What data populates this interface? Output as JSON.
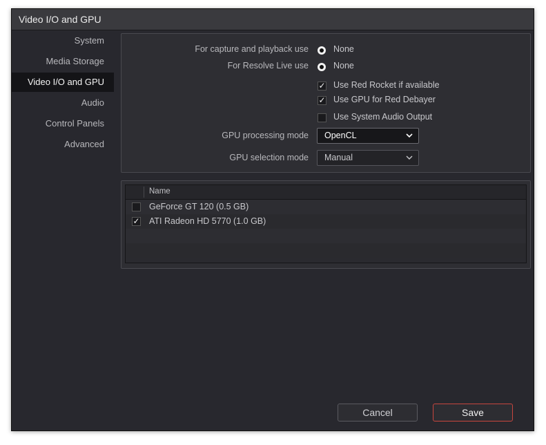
{
  "window": {
    "title": "Video I/O and GPU"
  },
  "sidebar": {
    "items": [
      {
        "label": "System",
        "active": false
      },
      {
        "label": "Media Storage",
        "active": false
      },
      {
        "label": "Video I/O and GPU",
        "active": true
      },
      {
        "label": "Audio",
        "active": false
      },
      {
        "label": "Control Panels",
        "active": false
      },
      {
        "label": "Advanced",
        "active": false
      }
    ]
  },
  "settings": {
    "capture_playback": {
      "label": "For capture and playback use",
      "value": "None"
    },
    "resolve_live": {
      "label": "For Resolve Live use",
      "value": "None"
    },
    "checkboxes": [
      {
        "label": "Use Red Rocket if available",
        "checked": true
      },
      {
        "label": "Use GPU for Red Debayer",
        "checked": true
      },
      {
        "label": "Use System Audio Output",
        "checked": false
      }
    ],
    "gpu_processing_mode": {
      "label": "GPU processing mode",
      "value": "OpenCL"
    },
    "gpu_selection_mode": {
      "label": "GPU selection mode",
      "value": "Manual"
    }
  },
  "gpu_table": {
    "header": "Name",
    "rows": [
      {
        "name": "GeForce GT 120 (0.5 GB)",
        "checked": false
      },
      {
        "name": "ATI Radeon HD 5770 (1.0 GB)",
        "checked": true
      }
    ]
  },
  "buttons": {
    "cancel": "Cancel",
    "save": "Save"
  },
  "icons": {
    "checkmark": "✓",
    "chevron": "chevron-down"
  },
  "colors": {
    "save_border": "#c8463e",
    "active_sidebar_bg": "#141417"
  }
}
